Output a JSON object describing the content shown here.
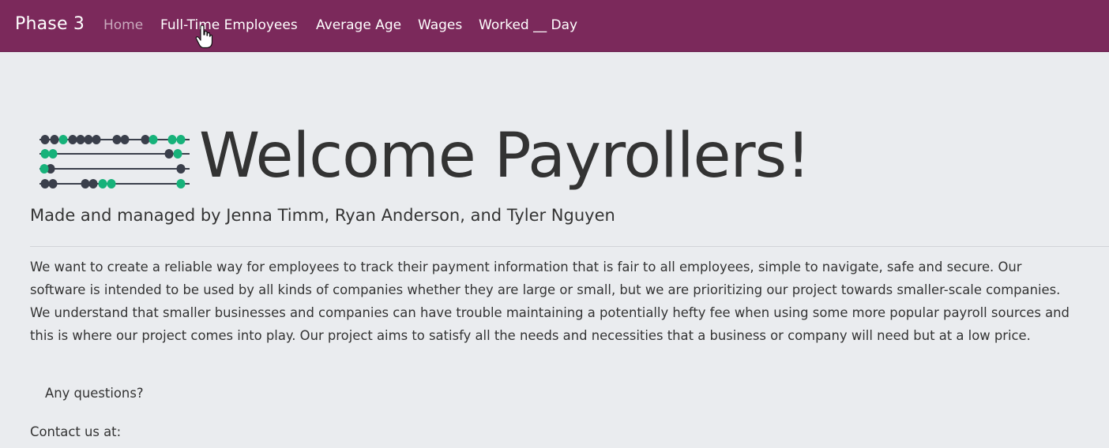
{
  "navbar": {
    "brand": "Phase 3",
    "links": [
      {
        "label": "Home",
        "active": false
      },
      {
        "label": "Full-Time Employees"
      },
      {
        "label": "Average Age"
      },
      {
        "label": "Wages"
      },
      {
        "label": "Worked __ Day"
      }
    ],
    "background_color": "#7b295b"
  },
  "hero": {
    "logo_icon": "abacus-icon",
    "title": "Welcome Payrollers!",
    "subtitle": "Made and managed by Jenna Timm, Ryan Anderson, and Tyler Nguyen"
  },
  "content": {
    "paragraph": "We want to create a reliable way for employees to track their payment information that is fair to all employees, simple to navigate, safe and secure. Our software is intended to be used by all kinds of companies whether they are large or small, but we are prioritizing our project towards smaller-scale companies. We understand that smaller businesses and companies can have trouble maintaining a potentially hefty fee when using some more popular payroll sources and this is where our project comes into play. Our project aims to satisfy all the needs and necessities that a business or company will need but at a low price.",
    "questions": "Any questions?",
    "contact": "Contact us at:"
  },
  "colors": {
    "bead_green": "#17b27a",
    "bead_dark": "#3a3f4b",
    "page_bg": "#eaecef"
  }
}
